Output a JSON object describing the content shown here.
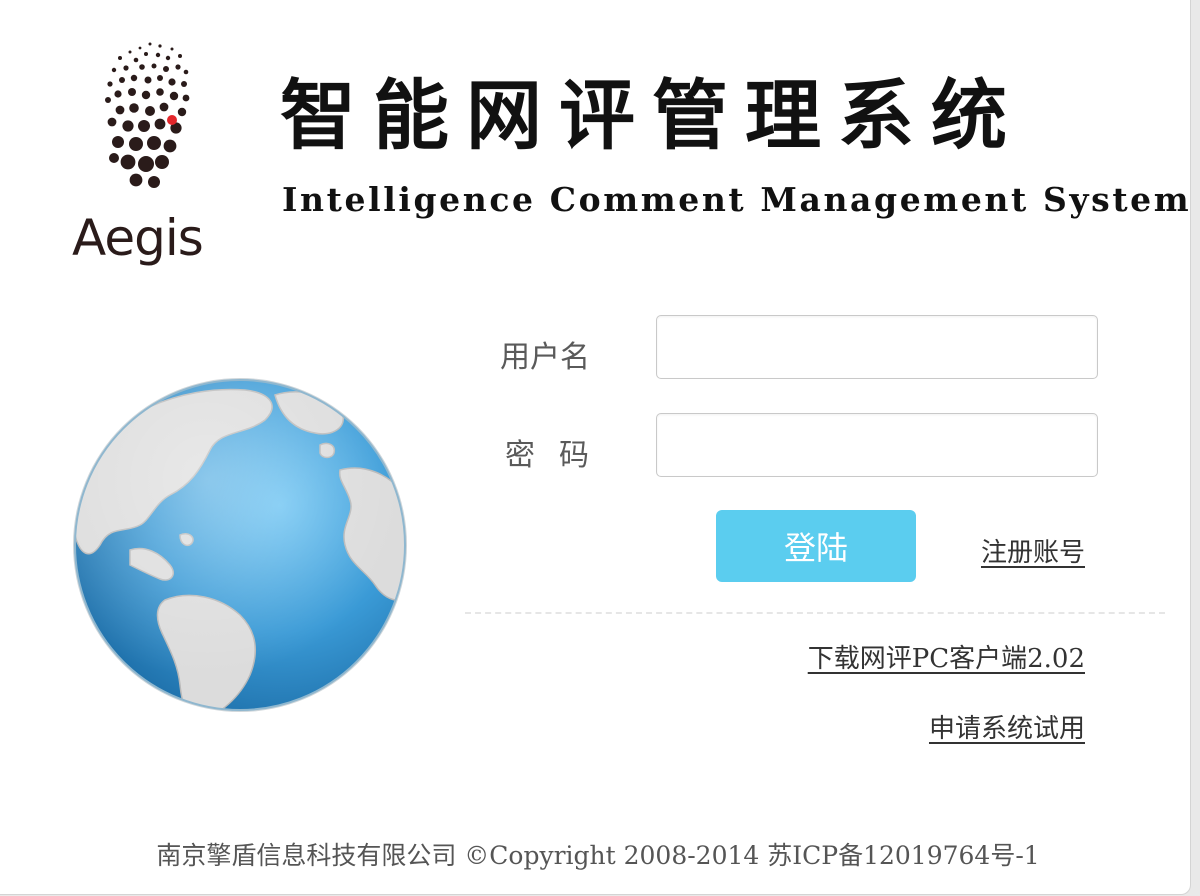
{
  "brand": {
    "logo_text": "Aegis",
    "title_cn": "智能网评管理系统",
    "title_en": "Intelligence Comment Management System"
  },
  "login_form": {
    "username_label": "用户名",
    "username_value": "",
    "password_label": "密码",
    "password_value": "",
    "login_button": "登陆",
    "register_link": "注册账号"
  },
  "links": {
    "download_client": "下载网评PC客户端2.02",
    "apply_trial": "申请系统试用"
  },
  "footer": {
    "text": "南京擎盾信息科技有限公司 ©Copyright 2008-2014 苏ICP备12019764号-1"
  },
  "colors": {
    "login_button": "#5bcdef",
    "logo_dots": "#2a1b1a",
    "logo_accent_dot": "#e3262b",
    "globe_ocean": "#3a9ad6",
    "globe_land": "#d9d9d9"
  },
  "icons": {
    "logo": "aegis-dots-logo",
    "globe": "globe-icon"
  }
}
